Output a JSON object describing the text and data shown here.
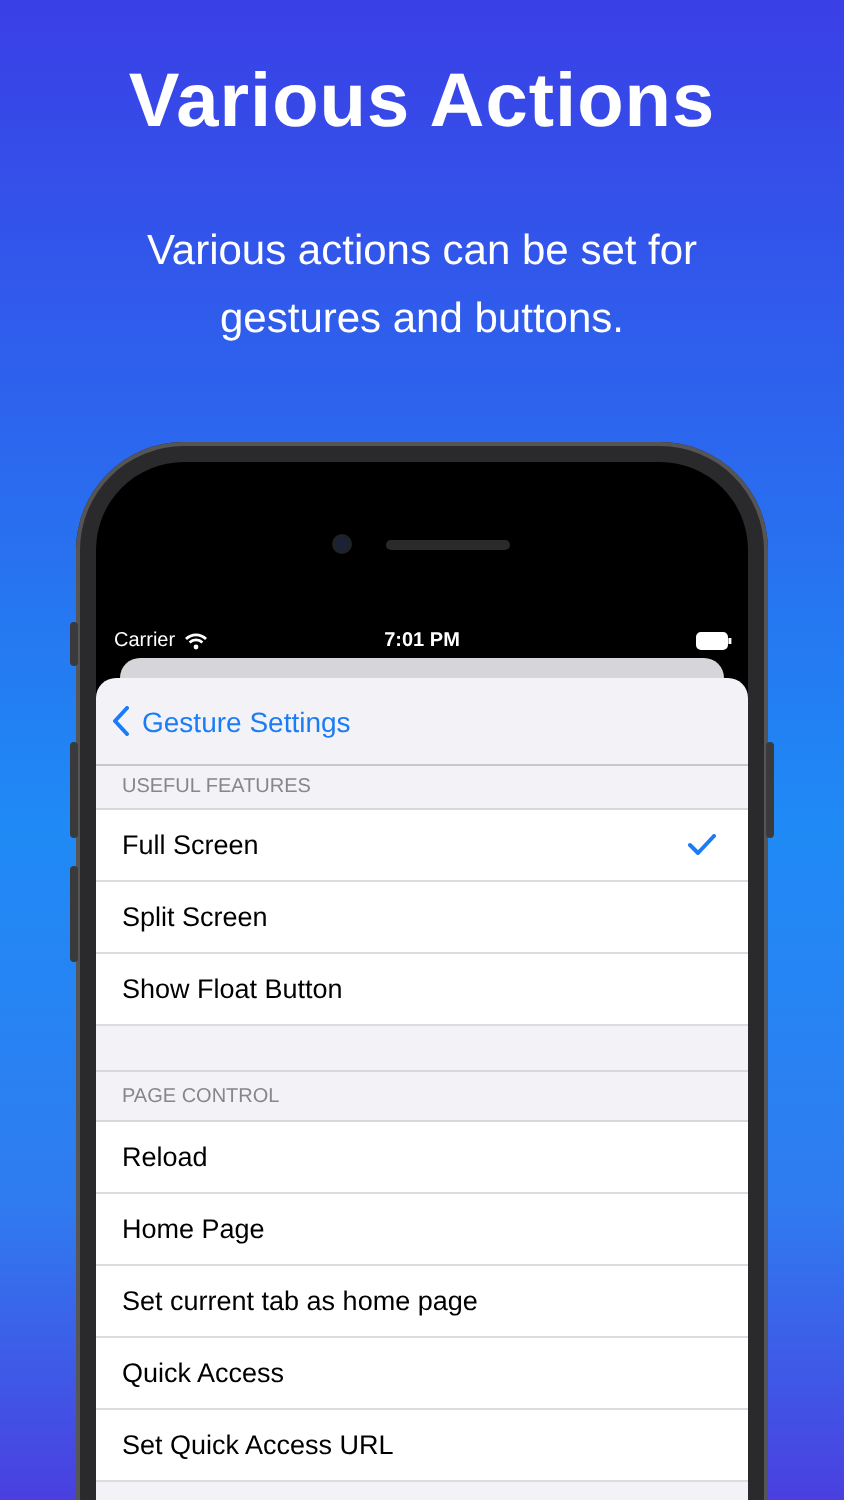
{
  "headline": "Various Actions",
  "subtitle": "Various actions can be set for gestures and buttons.",
  "status_bar": {
    "carrier": "Carrier",
    "time": "7:01 PM"
  },
  "nav": {
    "back_label": "Gesture Settings"
  },
  "sections": [
    {
      "header": "USEFUL FEATURES",
      "items": [
        {
          "label": "Full Screen",
          "checked": true
        },
        {
          "label": "Split Screen",
          "checked": false
        },
        {
          "label": "Show Float Button",
          "checked": false
        }
      ]
    },
    {
      "header": "PAGE CONTROL",
      "items": [
        {
          "label": "Reload",
          "checked": false
        },
        {
          "label": "Home Page",
          "checked": false
        },
        {
          "label": "Set current tab as home page",
          "checked": false
        },
        {
          "label": "Quick Access",
          "checked": false
        },
        {
          "label": "Set Quick Access URL",
          "checked": false
        }
      ]
    }
  ]
}
